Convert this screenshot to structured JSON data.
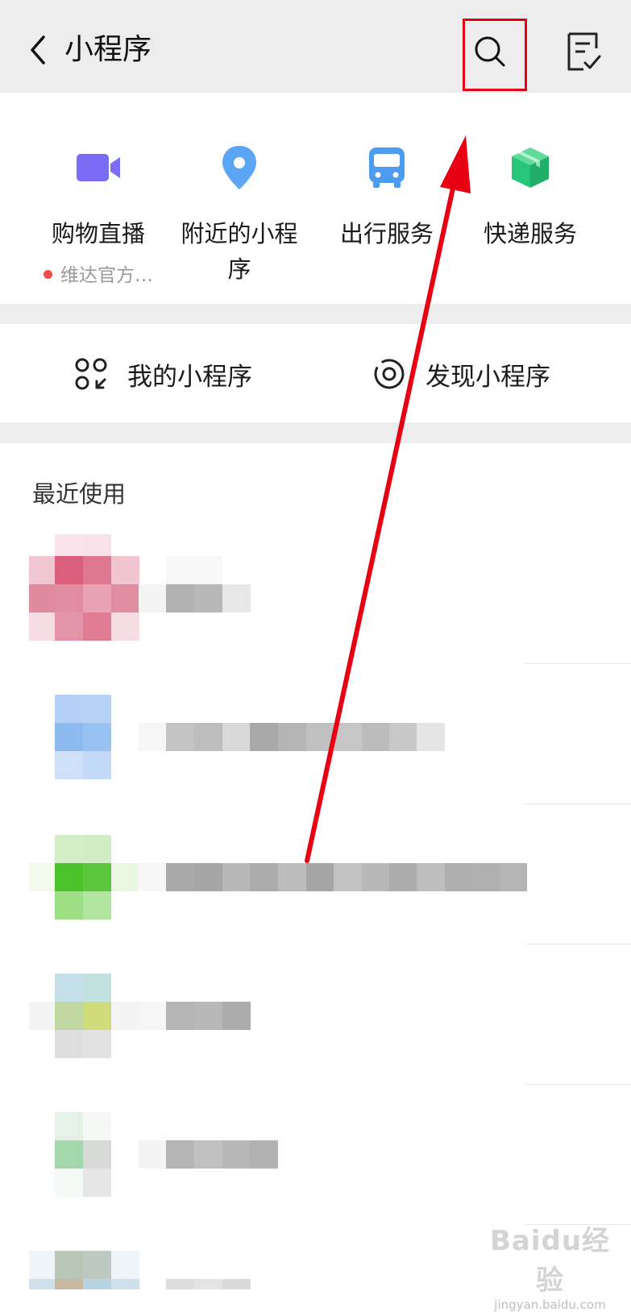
{
  "header": {
    "title": "小程序",
    "back_icon": "chevron-left-icon",
    "search_icon": "search-icon",
    "list_icon": "checklist-icon",
    "highlight_color": "#e60012"
  },
  "services": [
    {
      "label": "购物直播",
      "sub": "维达官方…",
      "icon": "video-camera-icon",
      "color": "#7b6cf6"
    },
    {
      "label": "附近的小程序",
      "icon": "location-pin-icon",
      "color": "#5aa6f5"
    },
    {
      "label": "出行服务",
      "icon": "bus-icon",
      "color": "#4d9cf0"
    },
    {
      "label": "快递服务",
      "icon": "package-box-icon",
      "color": "#27c578"
    }
  ],
  "entries": {
    "my": {
      "label": "我的小程序",
      "icon": "grid-dots-icon"
    },
    "discover": {
      "label": "发现小程序",
      "icon": "discover-target-icon"
    }
  },
  "recent": {
    "title": "最近使用"
  },
  "watermark": {
    "main": "Baidu经验",
    "sub": "jingyan.baidu.com"
  },
  "colors": {
    "annotation_arrow": "#e60012",
    "background_gray": "#ededed"
  }
}
